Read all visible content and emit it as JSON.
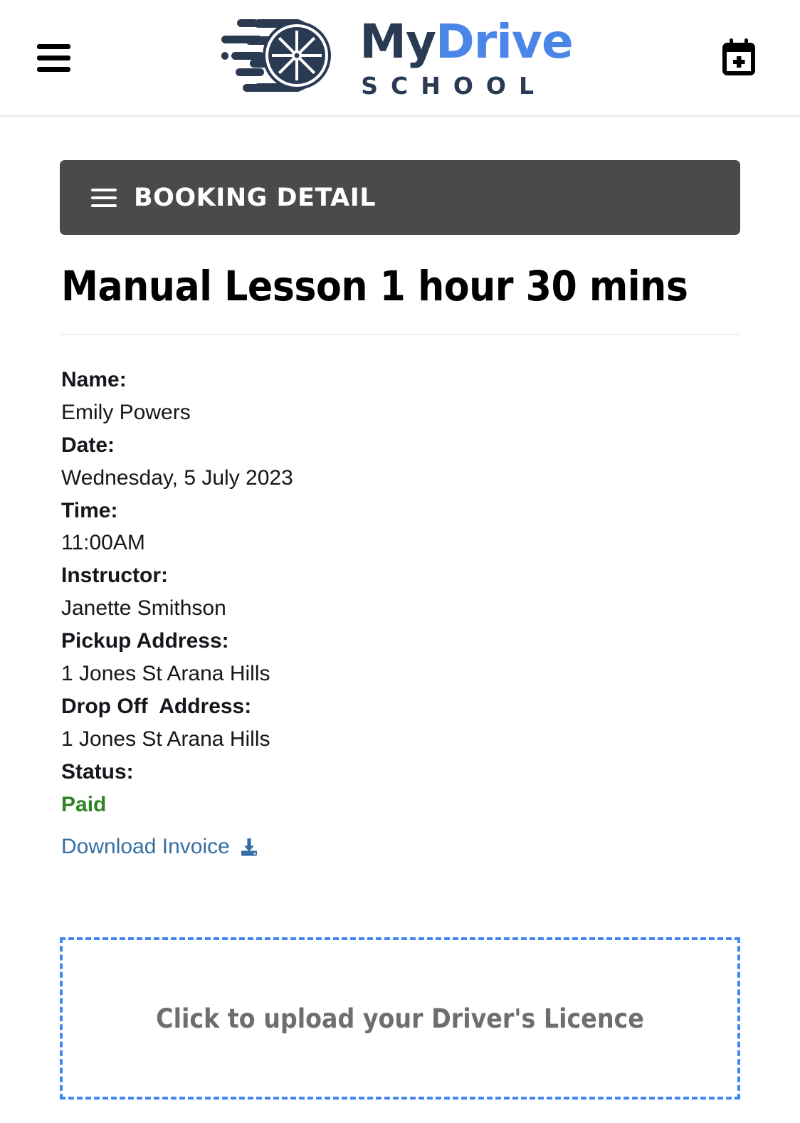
{
  "header": {
    "menu_icon": "hamburger-menu-icon",
    "logo": {
      "brand_part1": "My",
      "brand_part2": "Drive",
      "brand_sub": "SCHOOL",
      "mark_icon": "wheel-speed-logo-icon",
      "color_dark": "#2b3a53",
      "color_blue": "#4a86e8"
    },
    "add_booking_icon": "calendar-plus-icon"
  },
  "section": {
    "menu_icon": "hamburger-menu-icon",
    "title": "BOOKING DETAIL",
    "bar_color": "#4a4a4a"
  },
  "booking": {
    "lesson_title": "Manual Lesson 1 hour 30 mins",
    "fields": [
      {
        "label": "Name:",
        "value": "Emily Powers"
      },
      {
        "label": "Date:",
        "value": "Wednesday, 5 July 2023"
      },
      {
        "label": "Time:",
        "value": "11:00AM"
      },
      {
        "label": "Instructor:",
        "value": "Janette Smithson"
      },
      {
        "label": "Pickup Address:",
        "value": "1 Jones St Arana Hills"
      },
      {
        "label": "Drop Off  Address:",
        "value": "1 Jones St Arana Hills"
      }
    ],
    "status_label": "Status:",
    "status_value": "Paid",
    "status_color": "#2f8424",
    "invoice_link_label": "Download Invoice",
    "invoice_link_icon": "download-icon",
    "invoice_link_color": "#376fa3"
  },
  "upload": {
    "prompt": "Click to upload your Driver's Licence",
    "border_color": "#4285f4",
    "text_color": "#6e6e6e"
  }
}
